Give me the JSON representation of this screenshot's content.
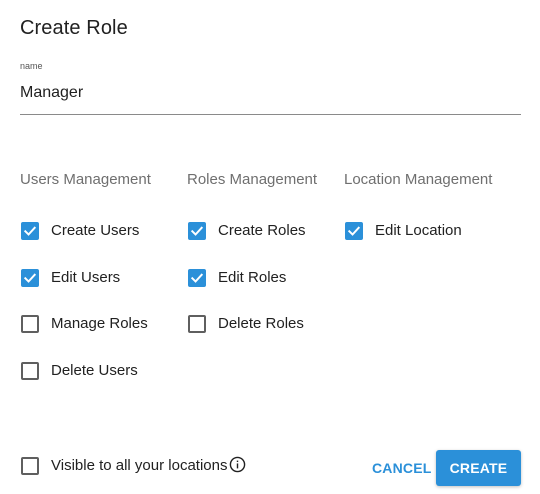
{
  "dialog": {
    "title": "Create Role"
  },
  "name_field": {
    "label": "name",
    "value": "Manager"
  },
  "groups": [
    {
      "title": "Users Management",
      "permissions": [
        {
          "label": "Create Users",
          "checked": true
        },
        {
          "label": "Edit Users",
          "checked": true
        },
        {
          "label": "Manage Roles",
          "checked": false
        },
        {
          "label": "Delete Users",
          "checked": false
        }
      ]
    },
    {
      "title": "Roles Management",
      "permissions": [
        {
          "label": "Create Roles",
          "checked": true
        },
        {
          "label": "Edit Roles",
          "checked": true
        },
        {
          "label": "Delete Roles",
          "checked": false
        }
      ]
    },
    {
      "title": "Location Management",
      "permissions": [
        {
          "label": "Edit Location",
          "checked": true
        }
      ]
    }
  ],
  "visibility": {
    "label": "Visible to all your locations",
    "checked": false,
    "icon": "info-icon"
  },
  "actions": {
    "cancel_label": "CANCEL",
    "create_label": "CREATE"
  },
  "colors": {
    "accent": "#2b90d9",
    "text": "#212121",
    "muted": "#6f6f6f"
  }
}
